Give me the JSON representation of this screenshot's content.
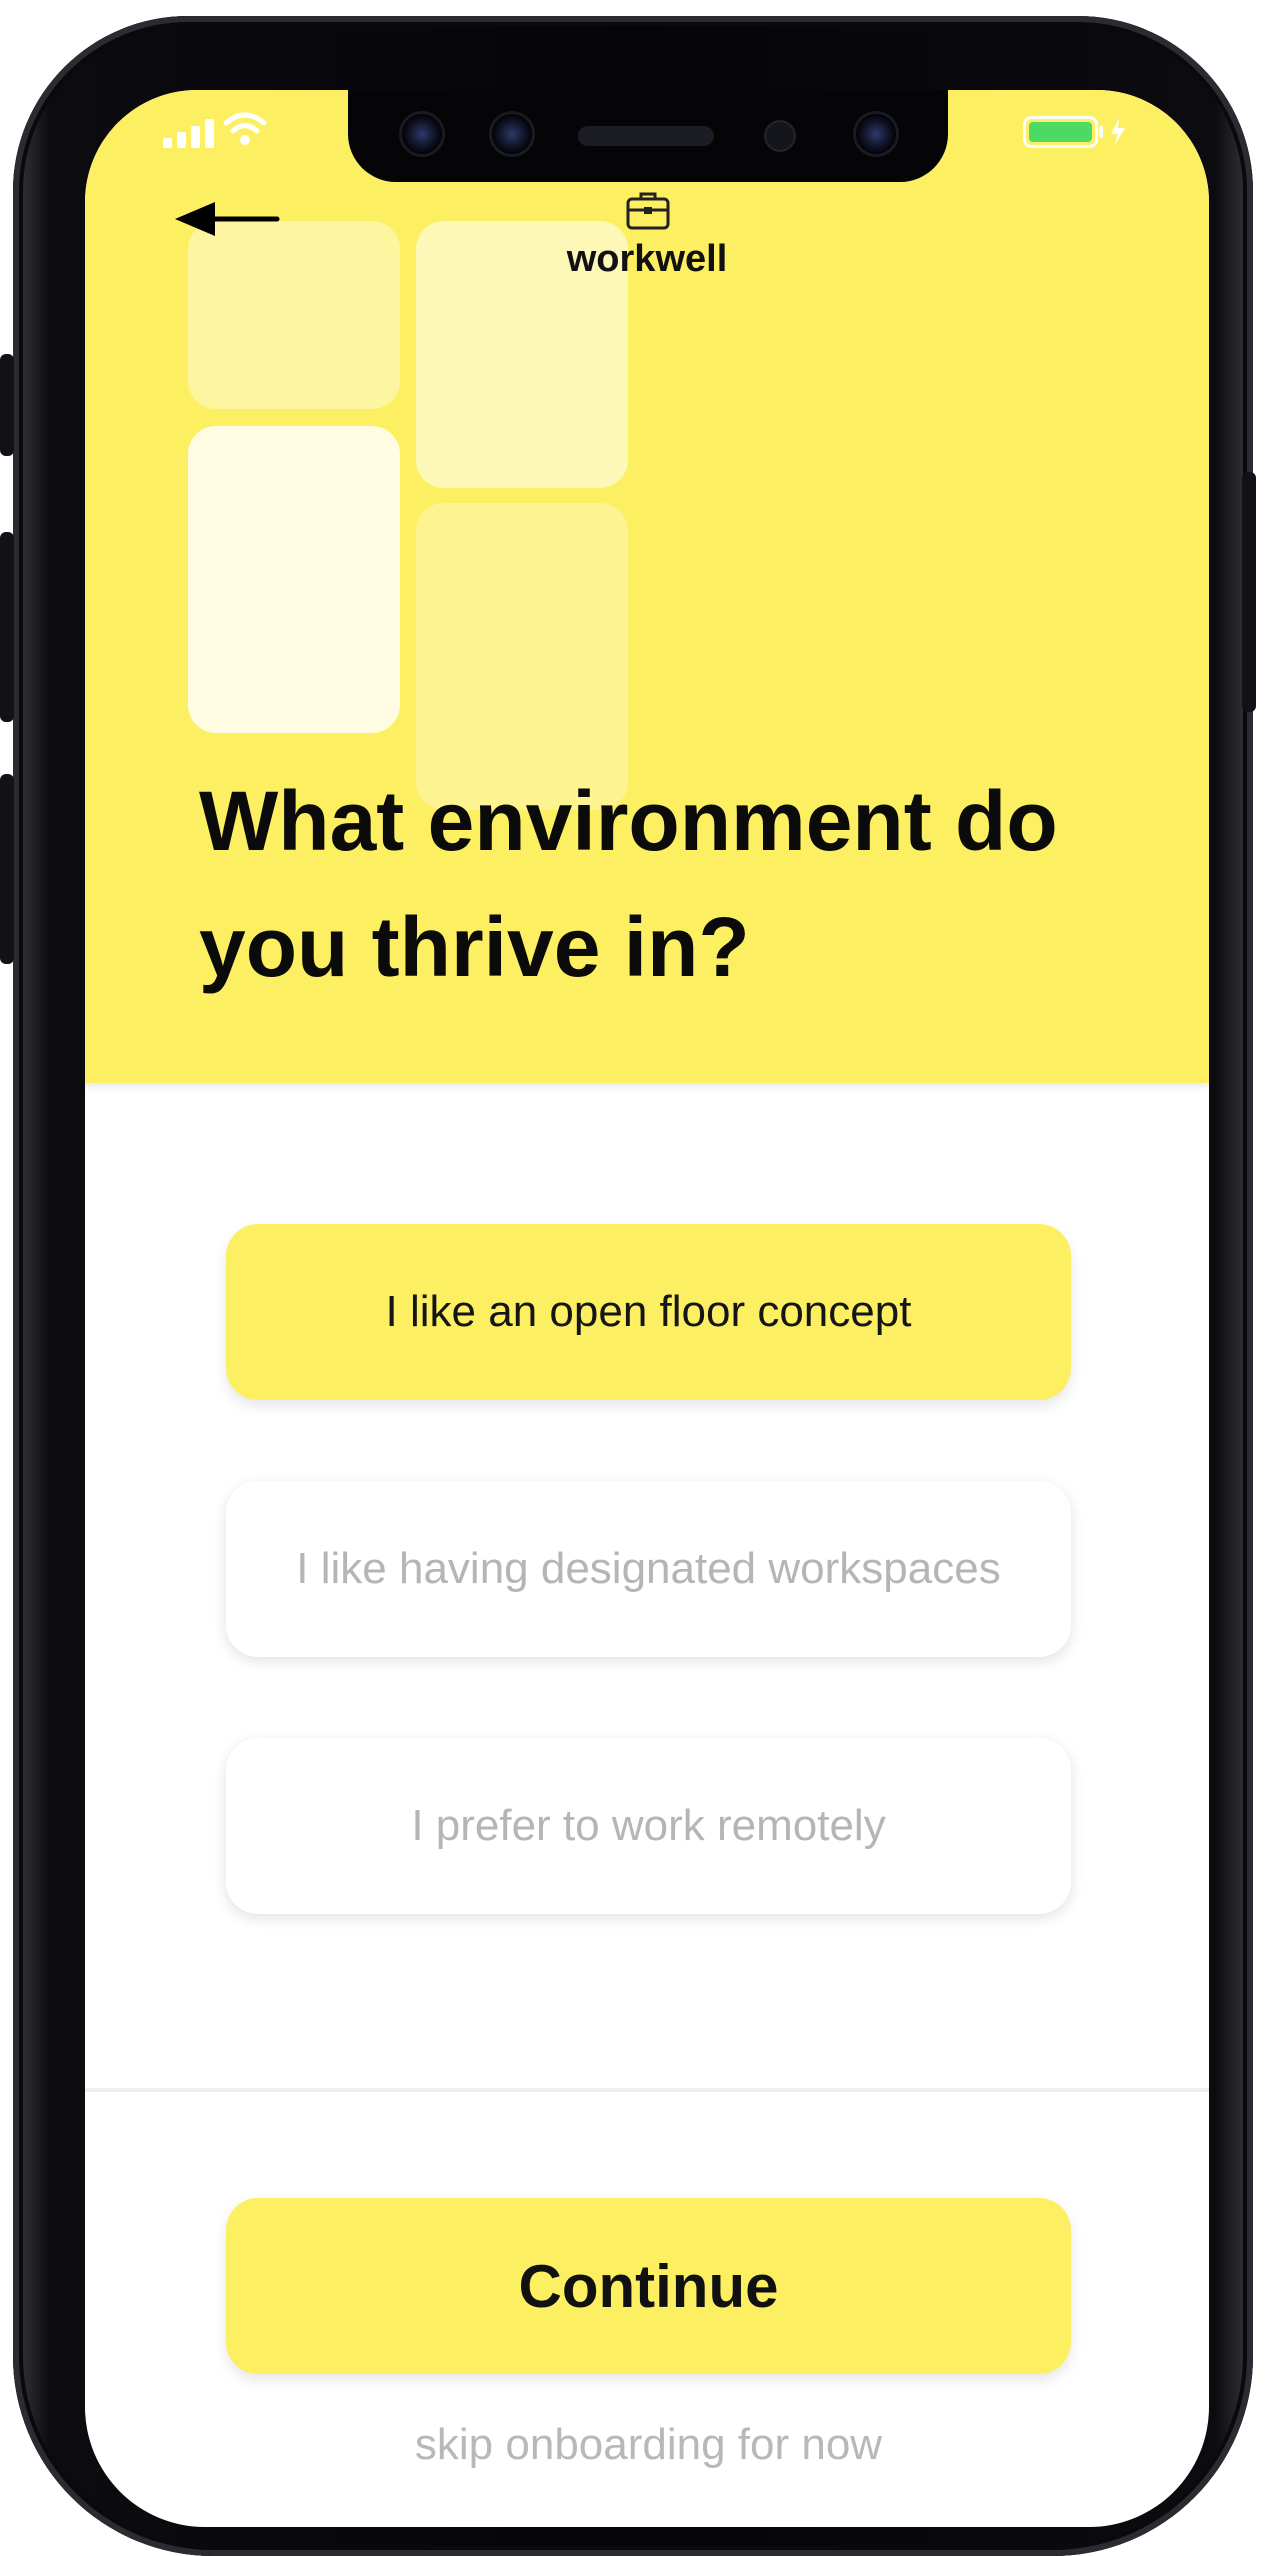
{
  "app": {
    "brand_name": "workwell",
    "brand_icon": "briefcase-icon"
  },
  "status_bar": {
    "icons": [
      "signal-icon",
      "wifi-icon",
      "battery-icon",
      "charging-icon"
    ],
    "battery_color": "#4cd964"
  },
  "header": {
    "back_icon": "arrow-left-icon"
  },
  "question": {
    "title": "What environment do you thrive in?"
  },
  "options": [
    {
      "label": "I like an open floor concept",
      "selected": true
    },
    {
      "label": "I like having designated workspaces",
      "selected": false
    },
    {
      "label": "I prefer to work remotely",
      "selected": false
    }
  ],
  "actions": {
    "continue_label": "Continue",
    "skip_label": "skip onboarding for now"
  },
  "colors": {
    "accent": "#fdef62",
    "text": "#111111",
    "muted_text": "#b5b5b5"
  }
}
